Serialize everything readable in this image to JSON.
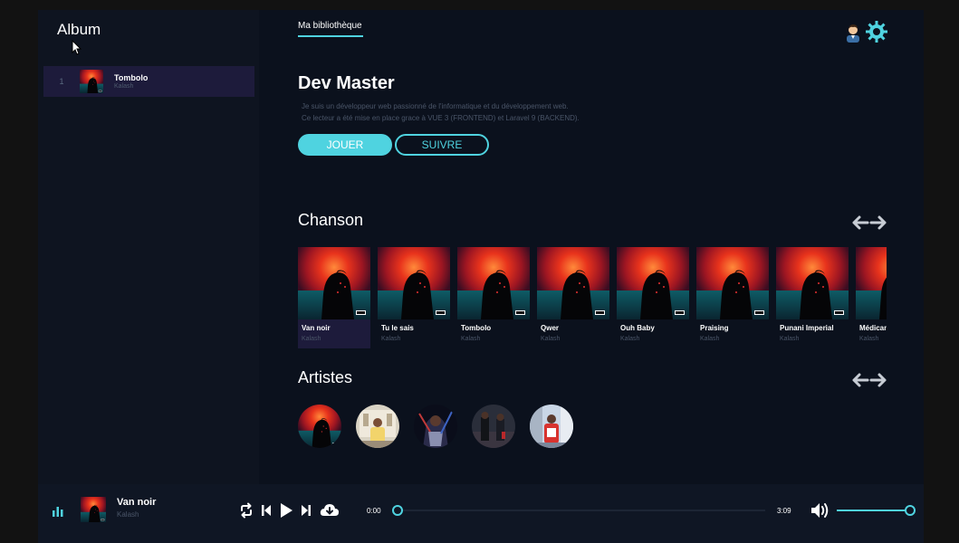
{
  "sidebar": {
    "title": "Album",
    "albums": [
      {
        "index": "1",
        "title": "Tombolo",
        "artist": "Kalash"
      }
    ]
  },
  "main": {
    "tab_label": "Ma bibliothèque",
    "profile": {
      "name": "Dev Master",
      "desc_line1": "Je suis un développeur web passionné de l'informatique et du développement web.",
      "desc_line2": "Ce lecteur a été mise en place grace à VUE 3 (FRONTEND) et Laravel 9 (BACKEND).",
      "play_label": "JOUER",
      "follow_label": "SUIVRE"
    },
    "songs_title": "Chanson",
    "songs": [
      {
        "title": "Van noir",
        "artist": "Kalash"
      },
      {
        "title": "Tu le sais",
        "artist": "Kalash"
      },
      {
        "title": "Tombolo",
        "artist": "Kalash"
      },
      {
        "title": "Qwer",
        "artist": "Kalash"
      },
      {
        "title": "Ouh Baby",
        "artist": "Kalash"
      },
      {
        "title": "Praising",
        "artist": "Kalash"
      },
      {
        "title": "Punani Imperial",
        "artist": "Kalash"
      },
      {
        "title": "Médicament",
        "artist": "Kalash"
      }
    ],
    "artists_title": "Artistes"
  },
  "player": {
    "title": "Van noir",
    "artist": "Kalash",
    "current_time": "0:00",
    "duration": "3:09",
    "progress": 0,
    "volume": 1.0
  },
  "colors": {
    "accent": "#4fd3e0",
    "active_row": "#1d1b3b"
  },
  "icons": [
    "cursor-icon",
    "user-icon",
    "gear-icon",
    "arrow-left-icon",
    "arrow-right-icon",
    "equalizer-icon",
    "repeat-icon",
    "previous-icon",
    "play-icon",
    "next-icon",
    "cloud-download-icon",
    "volume-icon"
  ]
}
